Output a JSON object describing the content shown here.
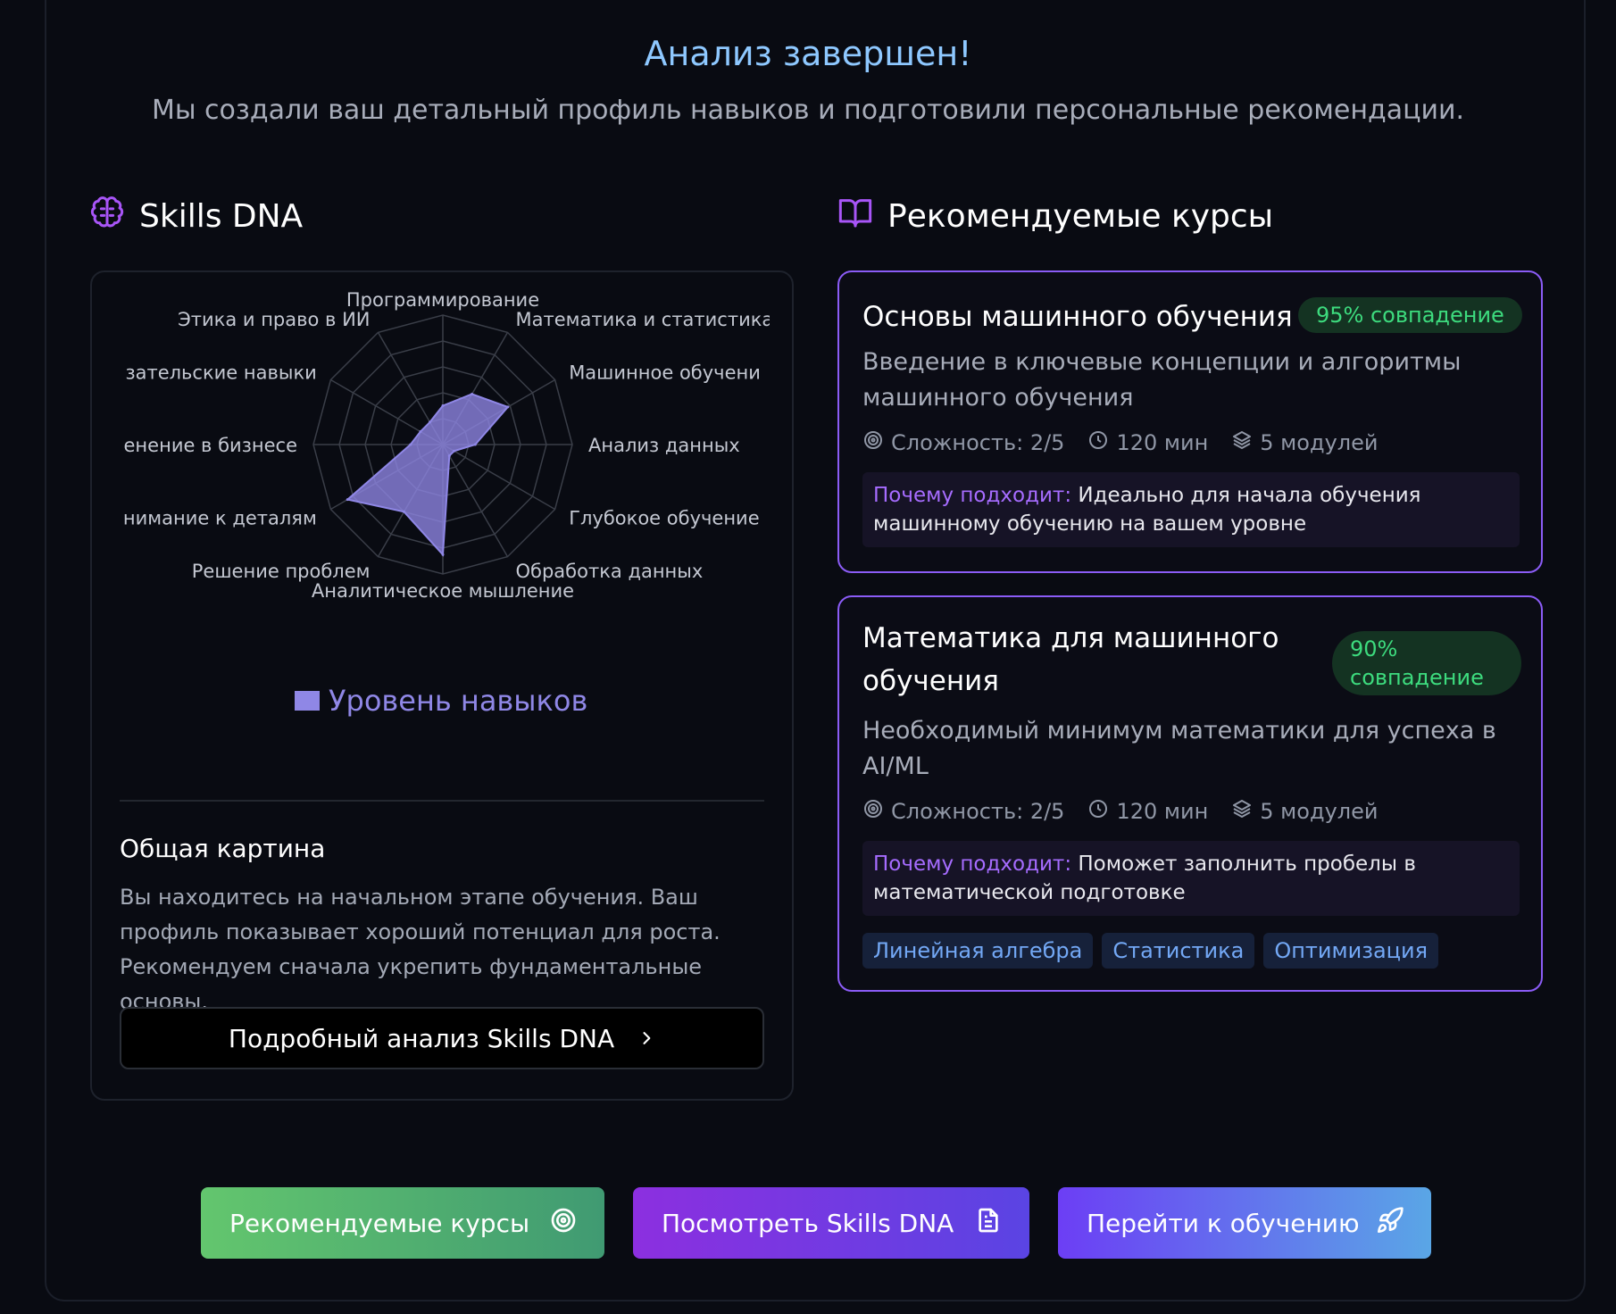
{
  "header": {
    "title": "Анализ завершен!",
    "subtitle": "Мы создали ваш детальный профиль навыков и подготовили персональные рекомендации."
  },
  "skills_section": {
    "title": "Skills DNA",
    "icon": "brain-icon",
    "legend_label": "Уровень навыков",
    "overview_title": "Общая картина",
    "overview_text": "Вы находитесь на начальном этапе обучения. Ваш профиль показывает хороший потенциал для роста. Рекомендуем сначала укрепить фундаментальные основы.",
    "detail_button": "Подробный анализ Skills DNA"
  },
  "chart_data": {
    "type": "radar",
    "categories": [
      "Программирование",
      "Математика и статистика",
      "Машинное обучени",
      "Анализ данных",
      "Глубокое обучение",
      "Обработка данных",
      "Аналитическое мышление",
      "Решение проблем",
      "нимание к деталям",
      "енение в бизнесе",
      "зательские навыки",
      "Этика и право в ИИ"
    ],
    "series": [
      {
        "name": "Уровень навыков",
        "values": [
          0.3,
          0.45,
          0.58,
          0.25,
          0.1,
          0.1,
          0.85,
          0.6,
          0.85,
          0.25,
          0.2,
          0.2
        ],
        "color": "#8f87e6"
      }
    ],
    "rmax": 1,
    "rings": 5
  },
  "courses_section": {
    "title": "Рекомендуемые курсы",
    "icon": "book-icon",
    "why_label": "Почему подходит:",
    "courses": [
      {
        "title": "Основы машинного обучения",
        "match": "95% совпадение",
        "description": "Введение в ключевые концепции и алгоритмы машинного обучения",
        "difficulty": "Сложность: 2/5",
        "duration": "120 мин",
        "modules": "5 модулей",
        "why": "Идеально для начала обучения машинному обучению на вашем уровне"
      },
      {
        "title_line1": "Математика для машинного",
        "title_line2": "обучения",
        "match_line1": "90%",
        "match_line2": "совпадение",
        "description": "Необходимый минимум математики для успеха в AI/ML",
        "difficulty": "Сложность: 2/5",
        "duration": "120 мин",
        "modules": "5 модулей",
        "why": "Поможет заполнить пробелы в математической подготовке",
        "tags": [
          "Линейная алгебра",
          "Статистика",
          "Оптимизация"
        ]
      }
    ]
  },
  "actions": {
    "courses_button": "Рекомендуемые курсы",
    "skills_button": "Посмотреть Skills DNA",
    "learn_button": "Перейти к обучению"
  },
  "colors": {
    "accent_purple": "#8b5cf6",
    "match_green": "#3ddb7e",
    "title_blue": "#8ec8ff",
    "radar_fill": "#8f87e6"
  }
}
